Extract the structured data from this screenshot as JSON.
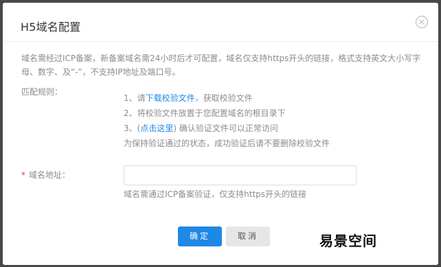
{
  "dialog": {
    "title": "H5域名配置",
    "description": "域名需经过ICP备案，新备案域名需24小时后才可配置，域名仅支持https开头的链接，格式支持英文大小写字母、数字、及“-”，不支持IP地址及端口号。"
  },
  "rules": {
    "label": "匹配规则：",
    "line1_prefix": "1、请",
    "line1_link": "下载校验文件",
    "line1_suffix": "，获取校验文件",
    "line2": "2、将校验文件放置于您配置域名的根目录下",
    "line3_prefix": "3、(",
    "line3_link": "点击这里",
    "line3_suffix": ") 确认验证文件可以正常访问",
    "line4": "为保持验证通过的状态，成功验证后请不要删除校验文件"
  },
  "domain": {
    "required_mark": "*",
    "label": "域名地址：",
    "value": "",
    "help": "域名需通过ICP备案验证，仅支持https开头的链接"
  },
  "buttons": {
    "confirm": "确定",
    "cancel": "取消"
  },
  "watermark": "易景空间",
  "icons": {
    "close": "close-icon"
  },
  "colors": {
    "primary": "#1e88e5",
    "required": "#e53935",
    "muted_text": "#8c8c8c"
  }
}
